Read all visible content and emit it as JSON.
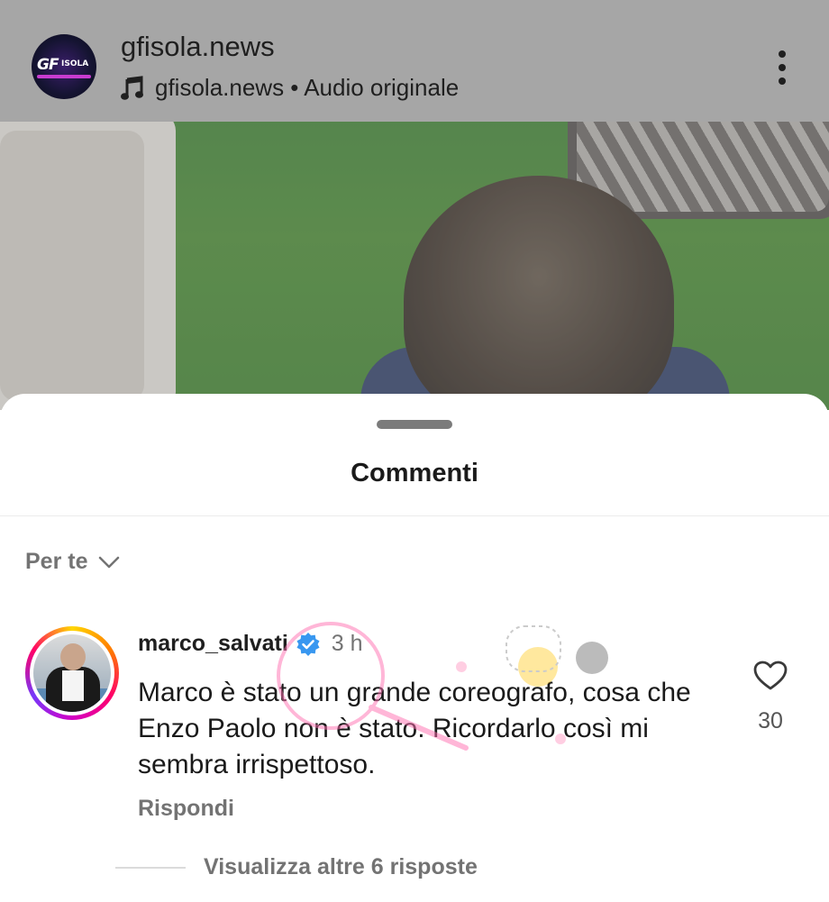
{
  "header": {
    "account_name": "gfisola.news",
    "audio_text": "gfisola.news • Audio originale",
    "avatar_logo": "GF",
    "avatar_logo_sub": "ISOLA",
    "icons": {
      "audio": "music-note-icon",
      "menu": "more-vertical-icon"
    }
  },
  "sheet": {
    "title": "Commenti",
    "sort_label": "Per te",
    "sort_icon": "chevron-down-icon"
  },
  "comment": {
    "username": "marco_salvati",
    "verified": true,
    "time": "3 h",
    "text": "Marco è stato un grande coreografo, cosa che Enzo Paolo non è stato. Ricordarlo così mi sembra irrispettoso.",
    "reply_label": "Rispondi",
    "like_count": "30",
    "view_replies_label": "Visualizza altre 6 risposte"
  },
  "colors": {
    "verified_blue": "#3897f0",
    "secondary_text": "#737373",
    "primary_text": "#1a1a1a",
    "header_bg": "#a6a6a6"
  }
}
